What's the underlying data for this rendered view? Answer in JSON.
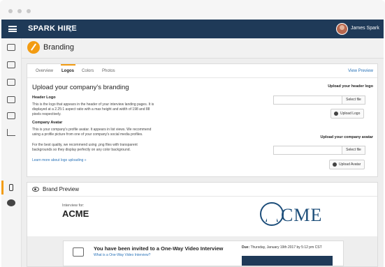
{
  "app": {
    "logo_text": "SPARK HIRE",
    "user_name": "James Spark"
  },
  "sidebar": {
    "items": [
      "video-icon",
      "briefcase-icon",
      "list-icon",
      "folders-icon",
      "layers-icon",
      "chart-icon",
      "brush-icon",
      "help-icon"
    ],
    "active": "brush-icon"
  },
  "page": {
    "title": "Branding"
  },
  "tabs": {
    "items": [
      "Overview",
      "Logos",
      "Colors",
      "Photos"
    ],
    "active": "Logos",
    "view_preview": "View Preview"
  },
  "logos": {
    "heading": "Upload your company's branding",
    "header_logo_title": "Header Logo",
    "header_logo_desc_1": "This is the logo that appears in the header of your interview landing pages. It is",
    "header_logo_desc_2": "displayed at a 2.25:1 aspect ratio with a max height and width of 198 and 88",
    "header_logo_desc_3": "pixels respectively.",
    "avatar_title": "Company Avatar",
    "avatar_desc_1": "This is your company's profile avatar. It appears in list views. We recommend",
    "avatar_desc_2": "using a profile picture from one of your company's social media profiles.",
    "best_desc_1": "For the best quality, we recommend using .png files with transparent",
    "best_desc_2": "backgrounds so they display perfectly on any color background.",
    "learn_more": "Learn more about logo uploading »",
    "upload_header_label": "Upload your header logo",
    "upload_avatar_label": "Upload your company avatar",
    "select_file": "Select file",
    "upload_logo_btn": "Upload Logo",
    "upload_avatar_btn": "Upload Avatar"
  },
  "preview": {
    "title": "Brand Preview",
    "interview_for": "Interview for:",
    "company": "ACME",
    "logo_text": "CME",
    "invite_title": "You have been invited to a One-Way Video Interview",
    "invite_link": "What is a One-Way Video Interview?",
    "due_label": "Due:",
    "due_value": "Thursday, January 19th 2017 by 5:12 pm CST"
  },
  "colors": {
    "accent": "#f39c12",
    "navy": "#1f3a58",
    "link": "#2a73b8"
  }
}
